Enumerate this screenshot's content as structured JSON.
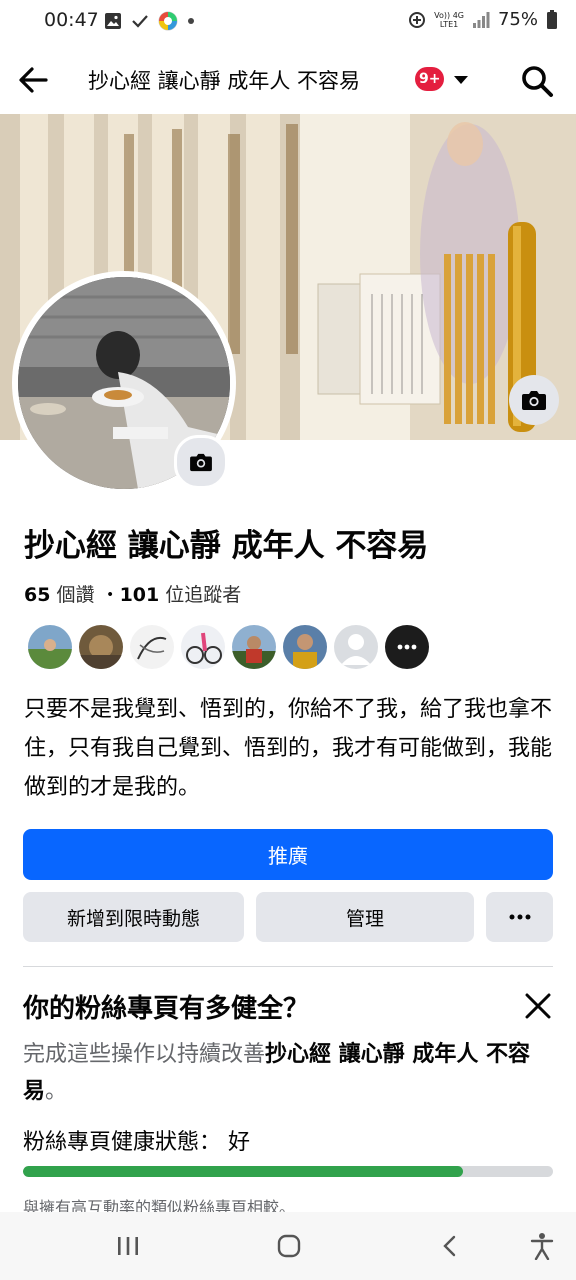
{
  "status_bar": {
    "time": "00:47",
    "battery": "75%",
    "net_top": "Vo)) 4G",
    "net_bottom": "LTE1"
  },
  "header": {
    "title": "抄心經 讓心靜 成年人 不容易",
    "badge": "9+"
  },
  "page": {
    "name": "抄心經 讓心靜 成年人 不容易",
    "likes_count": "65",
    "likes_label": "個讚",
    "separator": "・",
    "followers_count": "101",
    "followers_label": "位追蹤者",
    "bio": "只要不是我覺到、悟到的，你給不了我，給了我也拿不住，只有我自己覺到、悟到的，我才有可能做到，我能做到的才是我的。"
  },
  "buttons": {
    "promote": "推廣",
    "add_story": "新增到限時動態",
    "manage": "管理"
  },
  "health": {
    "title": "你的粉絲專頁有多健全？",
    "desc_prefix": "完成這些操作以持續改善",
    "desc_bold": "抄心經 讓心靜 成年人 不容易",
    "desc_suffix": "。",
    "status_label": "粉絲專頁健康狀態：",
    "status_value": "好",
    "progress": 0.83,
    "compare": "與擁有高互動率的類似粉絲專頁相較。"
  },
  "colors": {
    "primary": "#0866ff",
    "badge": "#e41e3f",
    "progress": "#31a24c"
  }
}
